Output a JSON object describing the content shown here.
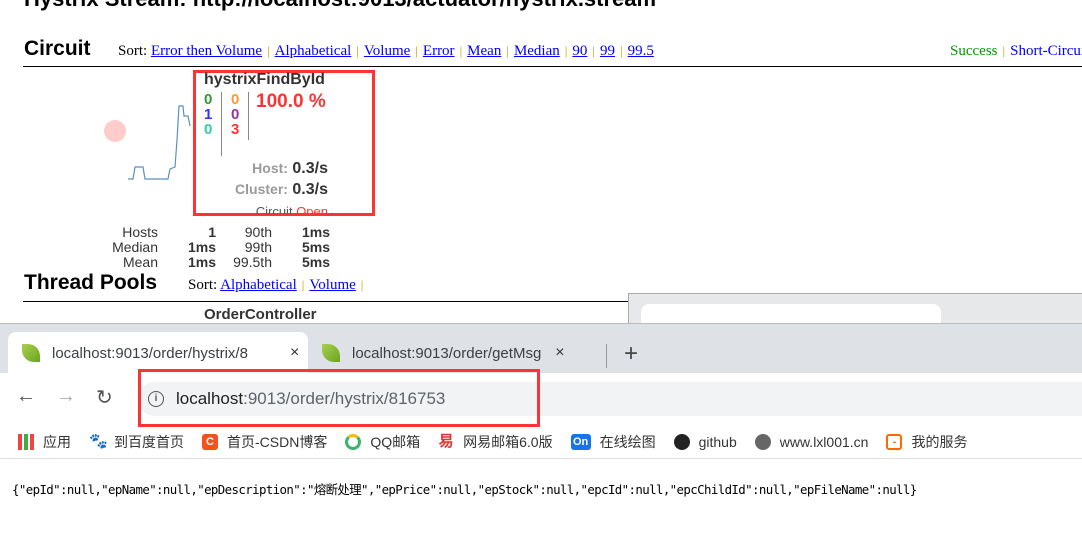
{
  "page_title": "Hystrix Stream: http://localhost:9013/actuator/hystrix.stream",
  "circuit_section": {
    "title": "Circuit",
    "sort_label": "Sort:",
    "sort_options": [
      "Error then Volume",
      "Alphabetical",
      "Volume",
      "Error",
      "Mean",
      "Median",
      "90",
      "99",
      "99.5"
    ],
    "legend": [
      "Success",
      "Short-Circuited"
    ],
    "legend_colors": {
      "success": "#009900",
      "short_circuited": "#0000ff"
    }
  },
  "circuit": {
    "name": "hystrixFindById",
    "col1": [
      "0",
      "1",
      "0"
    ],
    "col2": [
      "0",
      "0",
      "3"
    ],
    "error_pct": "100.0 %",
    "host_label": "Host:",
    "host_rate": "0.3/s",
    "cluster_label": "Cluster:",
    "cluster_rate": "0.3/s",
    "circuit_label": "Circuit",
    "circuit_status": "Open",
    "stats": {
      "hosts_label": "Hosts",
      "hosts": "1",
      "median_label": "Median",
      "median": "1ms",
      "mean_label": "Mean",
      "mean": "1ms",
      "p90_label": "90th",
      "p90": "1ms",
      "p99_label": "99th",
      "p99": "5ms",
      "p995_label": "99.5th",
      "p995": "5ms"
    },
    "colors": {
      "green": "#339933",
      "blue": "#3333ff",
      "teal": "#33ccaa",
      "orange": "#ff9933",
      "purple": "#993399",
      "red": "#ff3333"
    }
  },
  "thread_pools": {
    "title": "Thread Pools",
    "sort_label": "Sort:",
    "sort_options": [
      "Alphabetical",
      "Volume"
    ],
    "pool_name": "OrderController"
  },
  "browser": {
    "tabs": [
      {
        "title": "localhost:9013/order/hystrix/8",
        "active": true
      },
      {
        "title": "localhost:9013/order/getMsg",
        "active": false
      }
    ],
    "new_tab": "+",
    "close": "×",
    "url_host": "localhost",
    "url_rest": ":9013/order/hystrix/816753",
    "bookmarks": [
      {
        "label": "应用",
        "icon": "apps-grid-icon"
      },
      {
        "label": "到百度首页",
        "icon": "baidu-paw-icon"
      },
      {
        "label": "首页-CSDN博客",
        "icon": "csdn-icon"
      },
      {
        "label": "QQ邮箱",
        "icon": "qq-mail-icon"
      },
      {
        "label": "网易邮箱6.0版",
        "icon": "netease-icon"
      },
      {
        "label": "在线绘图",
        "icon": "processon-icon"
      },
      {
        "label": "github",
        "icon": "github-icon"
      },
      {
        "label": "www.lxl001.cn",
        "icon": "globe-icon"
      },
      {
        "label": "我的服务",
        "icon": "aliyun-icon"
      }
    ],
    "response_text": "{\"epId\":null,\"epName\":null,\"epDescription\":\"熔断处理\",\"epPrice\":null,\"epStock\":null,\"epcId\":null,\"epcChildId\":null,\"epFileName\":null}"
  }
}
